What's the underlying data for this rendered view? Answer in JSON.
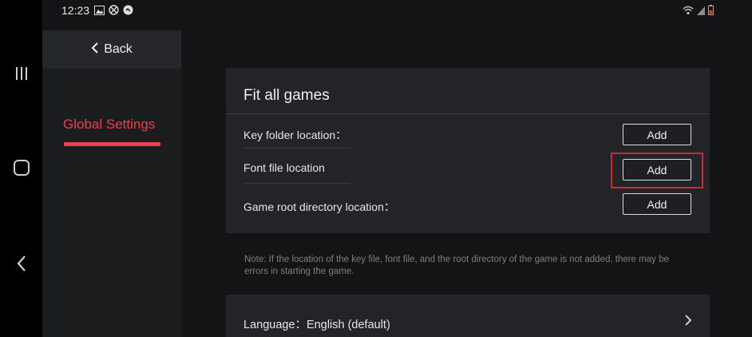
{
  "status_bar": {
    "time": "12:23",
    "left_icons": [
      "image-icon",
      "no-sim-icon",
      "app-icon"
    ],
    "right_icons": [
      "wifi-icon",
      "signal-icon",
      "battery-icon"
    ]
  },
  "nav_bar": {
    "buttons": [
      "recent-apps-icon",
      "home-icon",
      "back-icon"
    ]
  },
  "sidebar": {
    "back_label": "Back",
    "items": [
      {
        "label": "Global Settings",
        "active": true
      }
    ]
  },
  "main": {
    "card_title": "Fit all games",
    "rows": [
      {
        "label": "Key folder location：",
        "button": "Add"
      },
      {
        "label": "Font file location",
        "button": "Add"
      },
      {
        "label": "Game root directory location：",
        "button": "Add"
      }
    ],
    "note": "Note: If the location of the key file, font file, and the root directory of the game is not added, there may be errors in starting the game.",
    "language": {
      "label": "Language：",
      "value": "English (default)"
    }
  },
  "colors": {
    "accent": "#e8434d",
    "highlight": "#d2282e",
    "background": "#141416",
    "card": "#232427"
  }
}
